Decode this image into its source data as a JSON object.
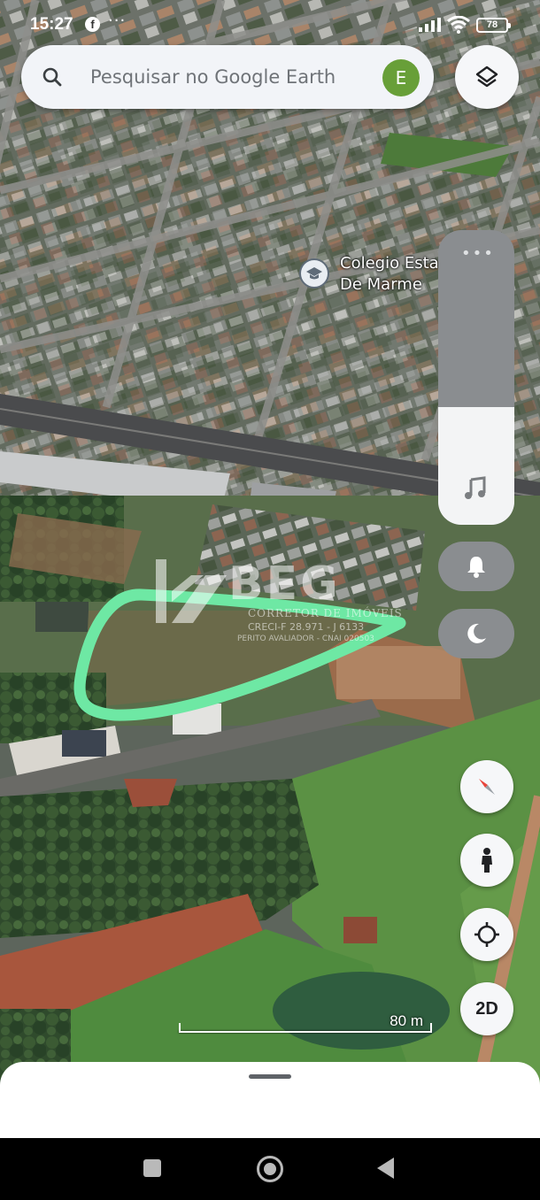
{
  "status_bar": {
    "time": "15:27",
    "app_icon": "facebook-icon",
    "more_indicator": "···",
    "battery": "78"
  },
  "search": {
    "placeholder": "Pesquisar no Google Earth",
    "avatar_letter": "E",
    "avatar_color": "#689f38"
  },
  "map": {
    "poi_label_line1": "Colegio Esta",
    "poi_label_line2": "De Marme",
    "poi_icon": "school-icon",
    "highlight_color": "#6ee8a4",
    "scale_label": "80 m"
  },
  "watermark": {
    "brand": "BEG",
    "line1": "CORRETOR DE IMÓVEIS",
    "line2": "CRECI-F 28.971 - J 6133",
    "line3": "PERITO AVALIADOR - CNAI 020503"
  },
  "side_panel": {
    "more_icon": "more-horiz-icon",
    "media_icon": "music-note-icon",
    "level": 0.6,
    "ring_icon": "bell-icon",
    "dnd_icon": "moon-icon"
  },
  "controls": {
    "compass_icon": "compass-icon",
    "street_view_icon": "pegman-icon",
    "location_icon": "my-location-icon",
    "view_mode_label": "2D"
  }
}
